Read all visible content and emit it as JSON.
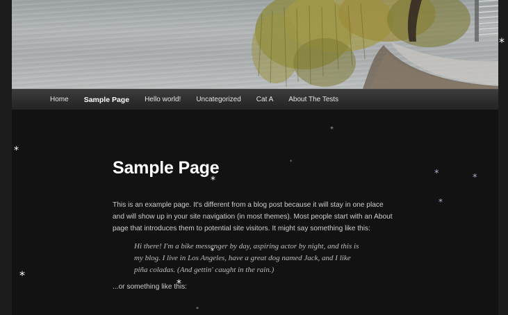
{
  "header": {
    "image_alt": "Snowy lakeside scene with willow tree"
  },
  "nav": {
    "items": [
      {
        "label": "Home",
        "current": false
      },
      {
        "label": "Sample Page",
        "current": true
      },
      {
        "label": "Hello world!",
        "current": false
      },
      {
        "label": "Uncategorized",
        "current": false
      },
      {
        "label": "Cat A",
        "current": false
      },
      {
        "label": "About The Tests",
        "current": false
      }
    ]
  },
  "main": {
    "title": "Sample Page",
    "intro_lines": [
      "This is an example page. It's different from a blog post because it will stay in one place",
      "and will show up in your site navigation (in most themes). Most people start with an About",
      "page that introduces them to potential site visitors. It might say something like this:"
    ],
    "quote_lines": [
      "Hi there! I'm a bike messenger by day, aspiring actor by night, and this is",
      "my blog. I live in Los Angeles, have a great dog named Jack, and I like",
      "piña coladas. (And gettin' caught in the rain.)"
    ],
    "outro": "...or something like this:"
  },
  "decor": {
    "snowflake_glyph": "*",
    "colors": {
      "page_bg": "#121212",
      "outer_bg": "#1c1c1c",
      "nav_bg": "#2c2c2c",
      "title": "#ffffff",
      "body_text": "#cfcfcf",
      "flake_blue": "#a9b2d6"
    }
  }
}
